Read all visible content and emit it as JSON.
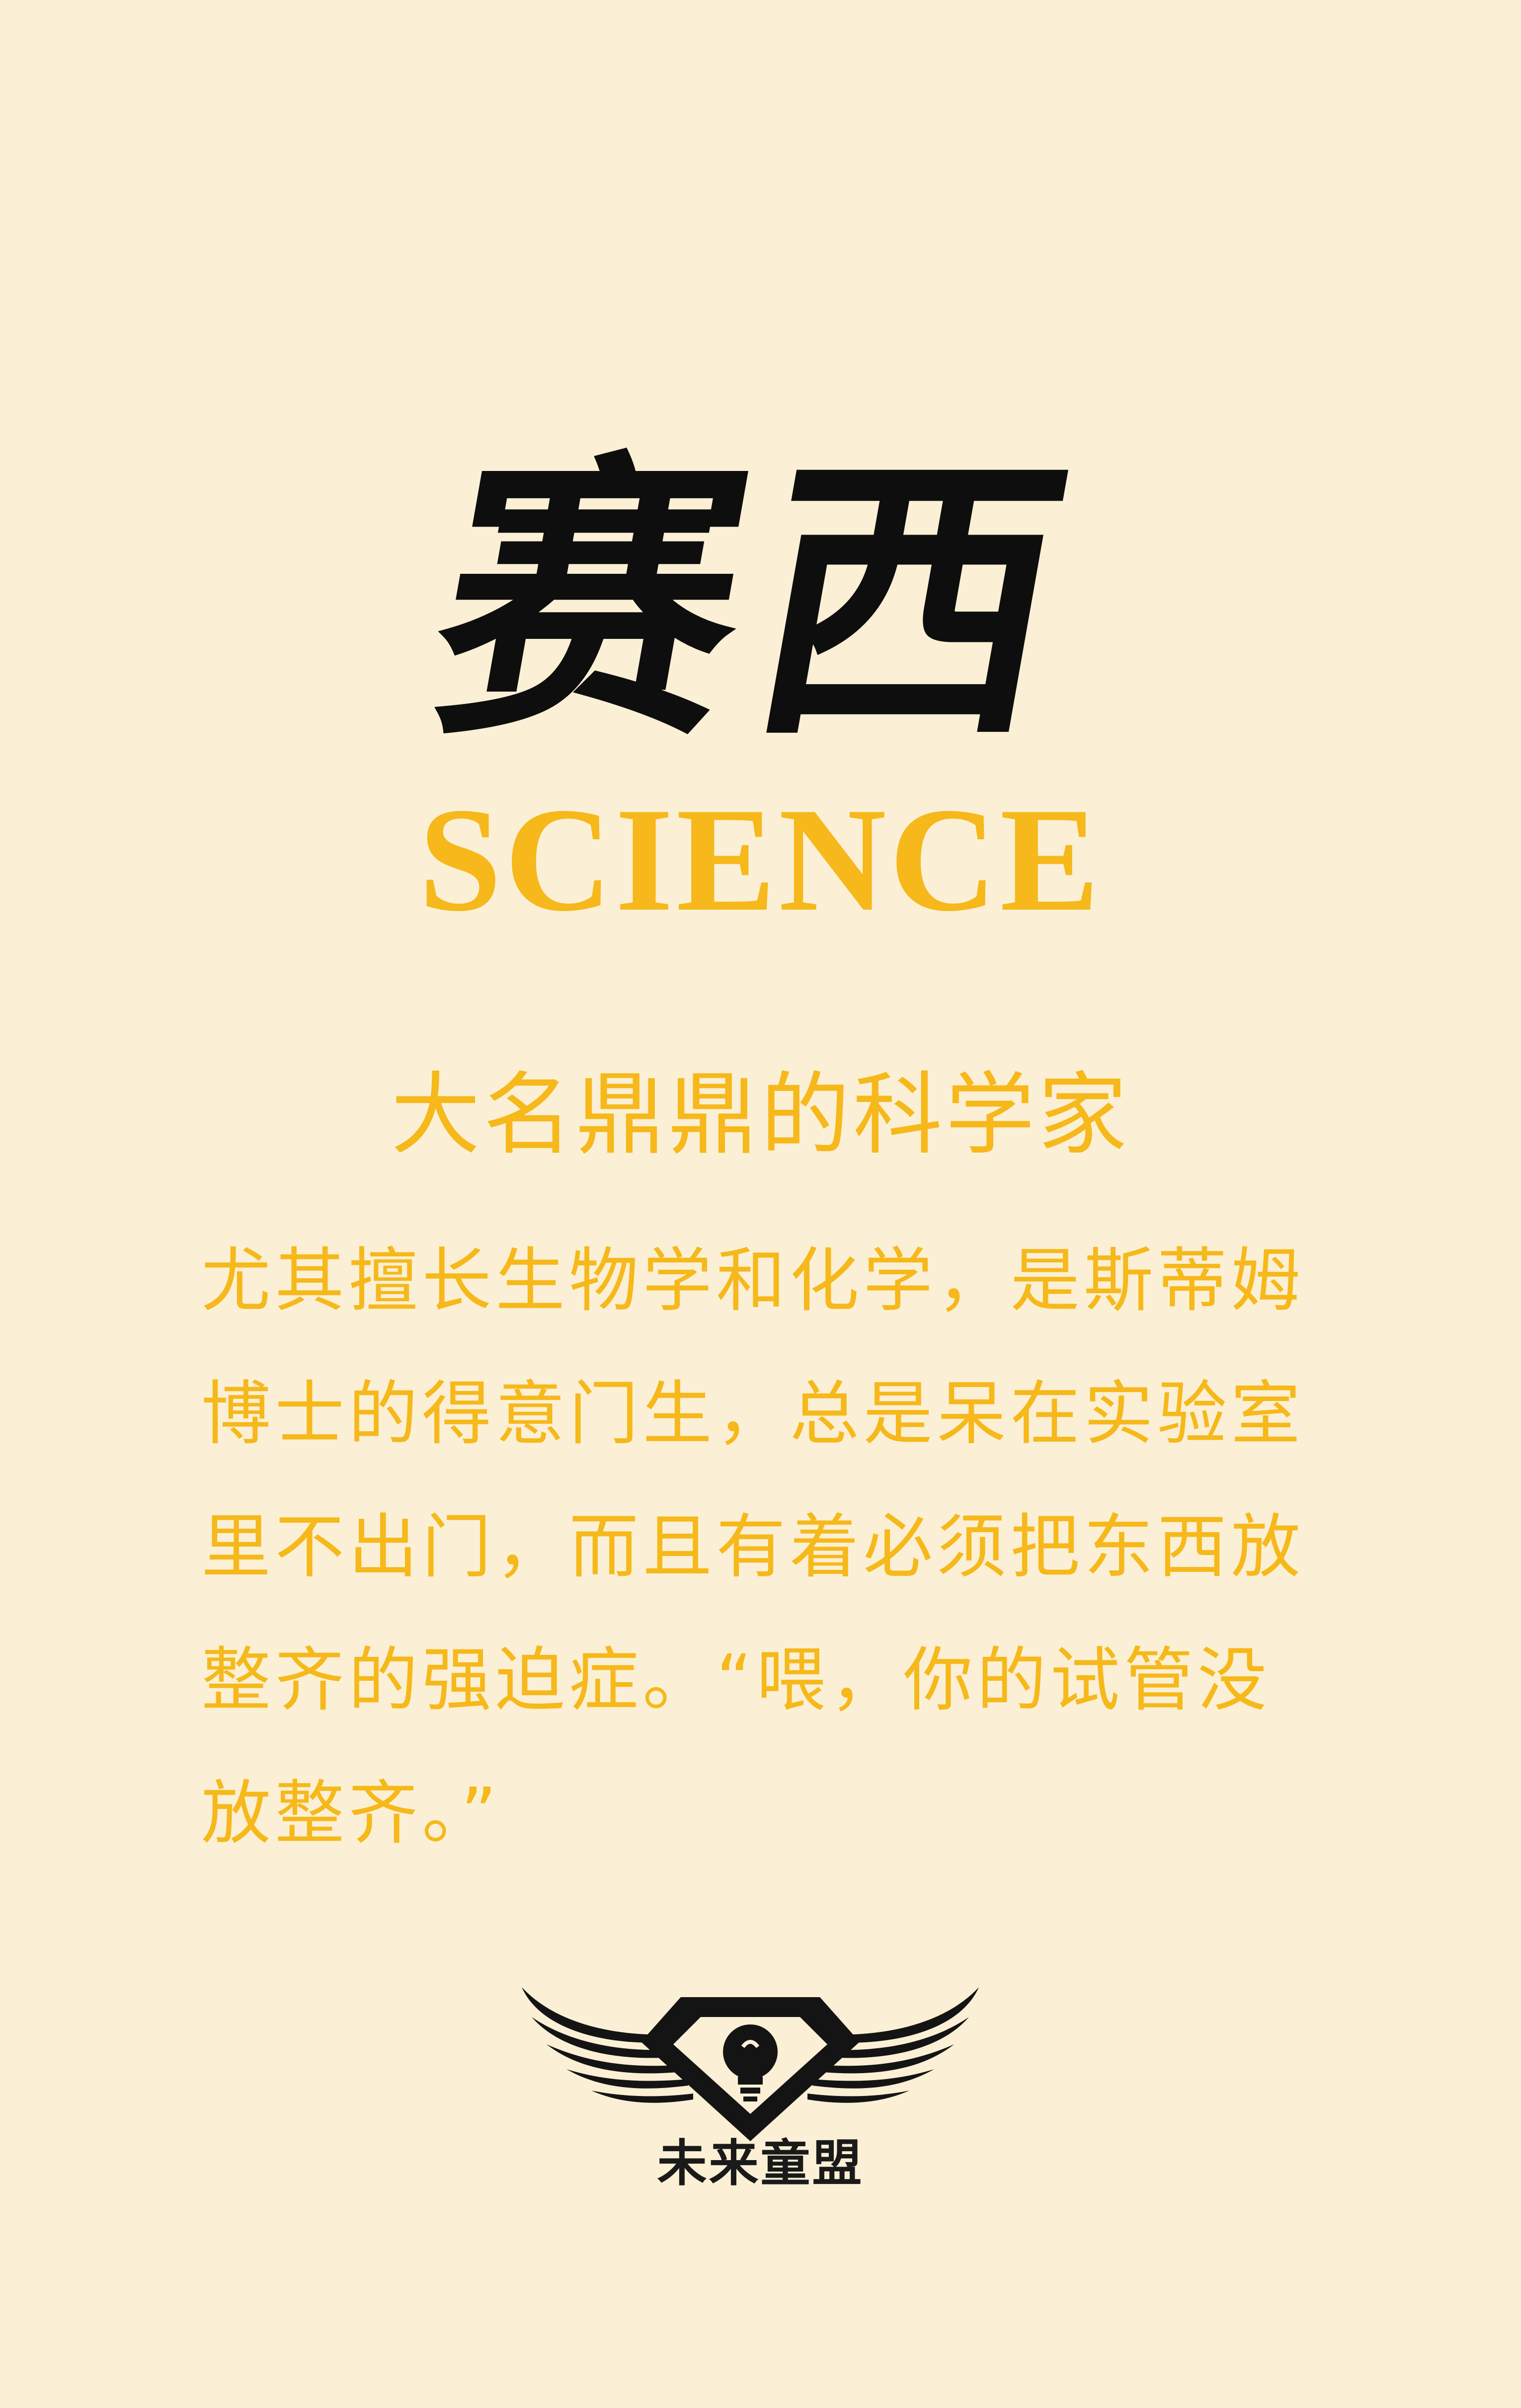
{
  "colors": {
    "background": "#fbf0d5",
    "accent": "#f6b81a",
    "ink": "#0e0e0e"
  },
  "card": {
    "calligraphy_title": "赛西",
    "english_title": "SCIENCE",
    "subtitle": "大名鼎鼎的科学家",
    "description_lines": [
      "尤其擅长生物学和化学，是斯蒂姆",
      "博士的得意门生，总是呆在实验室",
      "里不出门，而且有着必须把东西放",
      "整齐的强迫症。“喂，你的试管没",
      "放整齐。”"
    ]
  },
  "logo": {
    "icon": "winged-lightbulb-emblem",
    "brand_name": "未来童盟"
  }
}
